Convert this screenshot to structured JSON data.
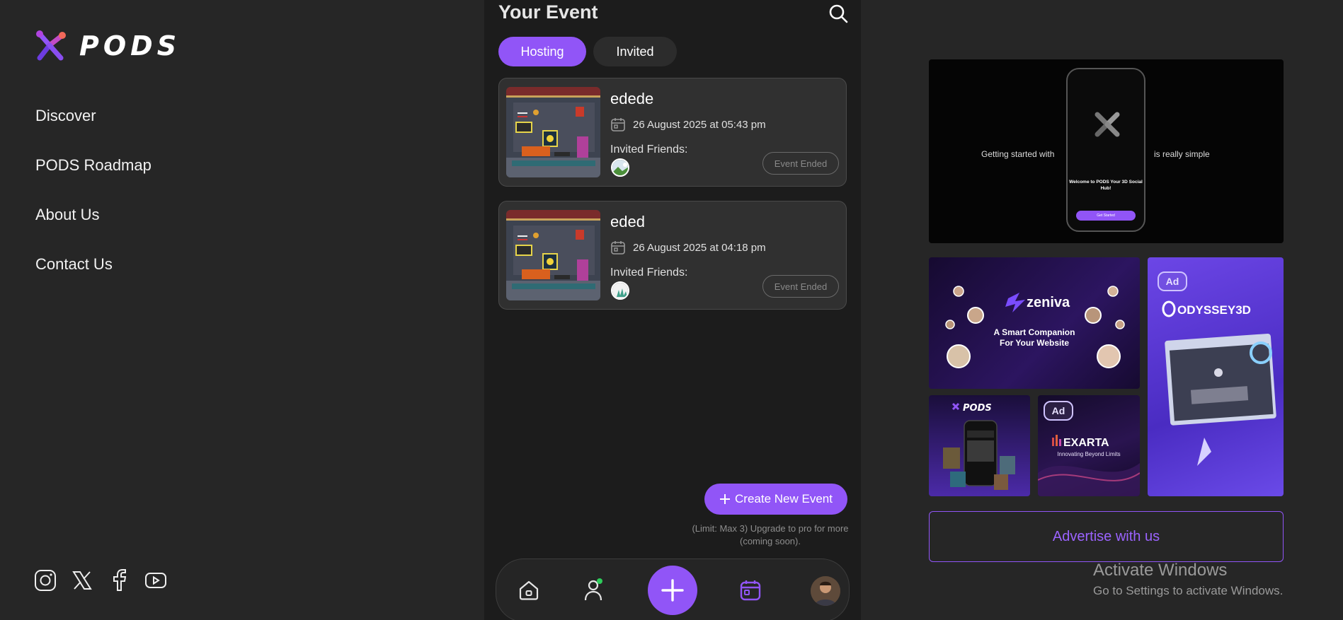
{
  "brand": {
    "name": "PODS",
    "accent": "#9155f7"
  },
  "sidebar": {
    "nav": [
      {
        "label": "Discover"
      },
      {
        "label": "PODS Roadmap"
      },
      {
        "label": "About Us"
      },
      {
        "label": "Contact Us"
      }
    ],
    "socials": [
      "instagram-icon",
      "x-icon",
      "facebook-icon",
      "youtube-icon"
    ]
  },
  "main": {
    "title": "Your Event",
    "tabs": [
      {
        "label": "Hosting",
        "active": true
      },
      {
        "label": "Invited",
        "active": false
      }
    ],
    "events": [
      {
        "name": "edede",
        "date": "26 August 2025 at 05:43 pm",
        "friends_label": "Invited Friends:",
        "status": "Event Ended"
      },
      {
        "name": "eded",
        "date": "26 August 2025 at 04:18 pm",
        "friends_label": "Invited Friends:",
        "status": "Event Ended"
      }
    ],
    "create_button": "Create New Event",
    "limit_note": "(Limit: Max 3) Upgrade to pro for more (coming soon)."
  },
  "bottom_nav": [
    "home-icon",
    "profile-icon",
    "plus-icon",
    "calendar-icon",
    "avatar"
  ],
  "ads": {
    "promo": {
      "left_text": "Getting started with",
      "right_text": "is really simple",
      "phone_title": "Welcome to PODS Your 3D Social Hub!",
      "phone_button": "Get Started"
    },
    "zeniva": {
      "brand": "zeniva",
      "tagline": "A Smart Companion For Your Website"
    },
    "odyssey": {
      "badge": "Ad",
      "brand": "ODYSSEY3D"
    },
    "pods": {
      "brand": "PODS"
    },
    "exarta": {
      "badge": "Ad",
      "brand": "EXARTA",
      "tagline": "Innovating Beyond Limits"
    },
    "advertise_button": "Advertise with us"
  },
  "os_overlay": {
    "line1": "Activate Windows",
    "line2": "Go to Settings to activate Windows."
  }
}
